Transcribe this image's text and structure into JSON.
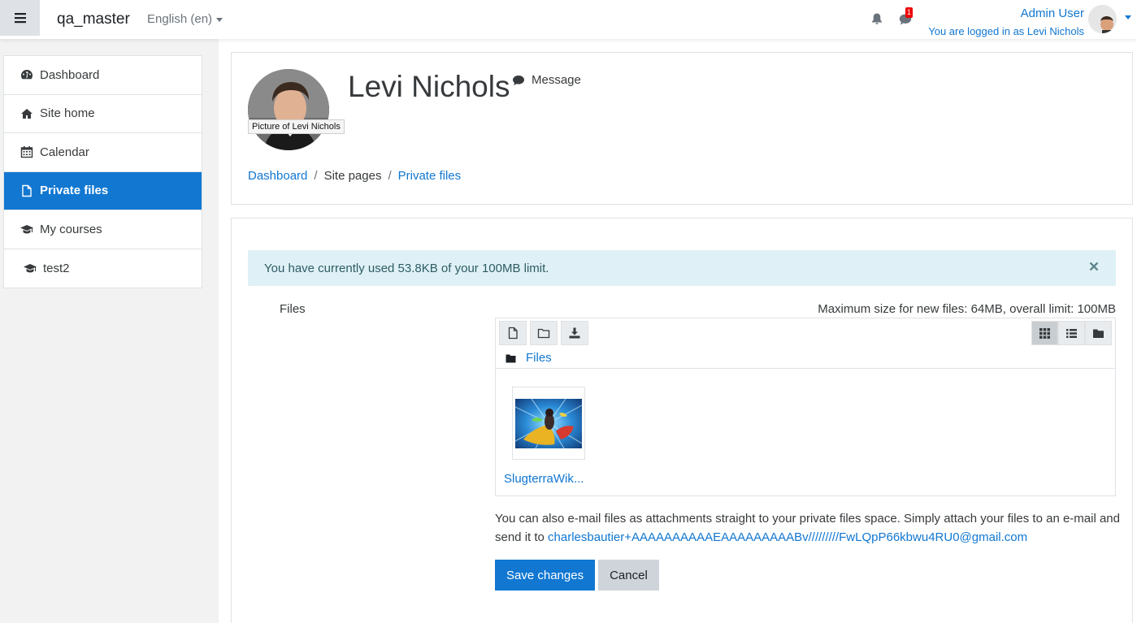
{
  "navbar": {
    "site_name": "qa_master",
    "language": "English (en)",
    "message_count": "1",
    "user_name": "Admin User",
    "logged_in_as": "You are logged in as Levi Nichols"
  },
  "drawer": {
    "items": [
      {
        "label": "Dashboard",
        "icon": "dashboard-icon"
      },
      {
        "label": "Site home",
        "icon": "home-icon"
      },
      {
        "label": "Calendar",
        "icon": "calendar-icon"
      },
      {
        "label": "Private files",
        "icon": "file-icon",
        "active": true
      },
      {
        "label": "My courses",
        "icon": "graduation-cap-icon"
      },
      {
        "label": "test2",
        "icon": "graduation-cap-icon"
      }
    ]
  },
  "header": {
    "picture_tooltip": "Picture of Levi Nichols",
    "name": "Levi Nichols",
    "message_label": "Message",
    "breadcrumb": [
      "Dashboard",
      "Site pages",
      "Private files"
    ]
  },
  "content": {
    "alert": "You have currently used 53.8KB of your 100MB limit.",
    "files_label": "Files",
    "max_size": "Maximum size for new files: 64MB, overall limit: 100MB",
    "folder_path": "Files",
    "file_name": "SlugterraWik...",
    "email_text": "You can also e-mail files as attachments straight to your private files space. Simply attach your files to an e-mail and send it to ",
    "email_address": "charlesbautier+AAAAAAAAAAEAAAAAAAAABv/////////FwLQpP66kbwu4RU0@gmail.com",
    "save_label": "Save changes",
    "cancel_label": "Cancel"
  },
  "colors": {
    "primary": "#1177d1",
    "alert_bg": "#dff1f6",
    "badge": "#e00000"
  }
}
